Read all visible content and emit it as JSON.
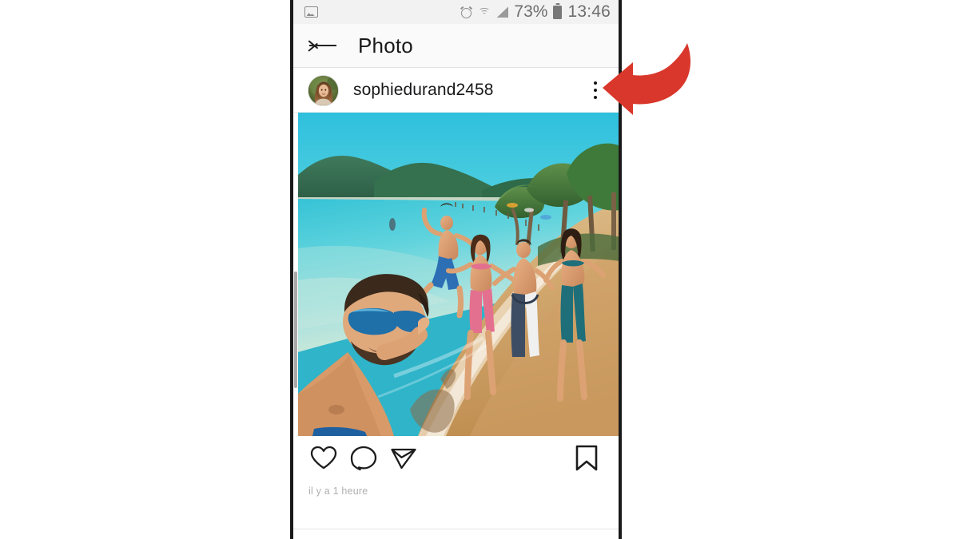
{
  "screen": {
    "device_frame_color": "#1a1a1a",
    "background": "#ffffff"
  },
  "status_bar": {
    "gallery_icon": "gallery-icon",
    "alarm_icon": "alarm-clock-icon",
    "wifi_icon": "wifi-icon",
    "signal_icon": "cellular-signal-icon",
    "battery_percent": "73%",
    "battery_icon": "battery-icon",
    "time": "13:46"
  },
  "app_bar": {
    "back_icon": "back-arrow-icon",
    "title": "Photo"
  },
  "post": {
    "avatar_alt": "user-avatar",
    "username": "sophiedurand2458",
    "more_icon": "more-options-icon",
    "photo_alt": "beach-selfie-photo",
    "timestamp": "il y a 1 heure"
  },
  "actions": {
    "like_icon": "heart-icon",
    "comment_icon": "comment-bubble-icon",
    "share_icon": "share-paper-plane-icon",
    "save_icon": "bookmark-icon"
  },
  "annotation": {
    "arrow_color": "#d9372b",
    "arrow_icon": "curved-red-arrow-pointing-left",
    "points_to": "more-options-icon"
  }
}
